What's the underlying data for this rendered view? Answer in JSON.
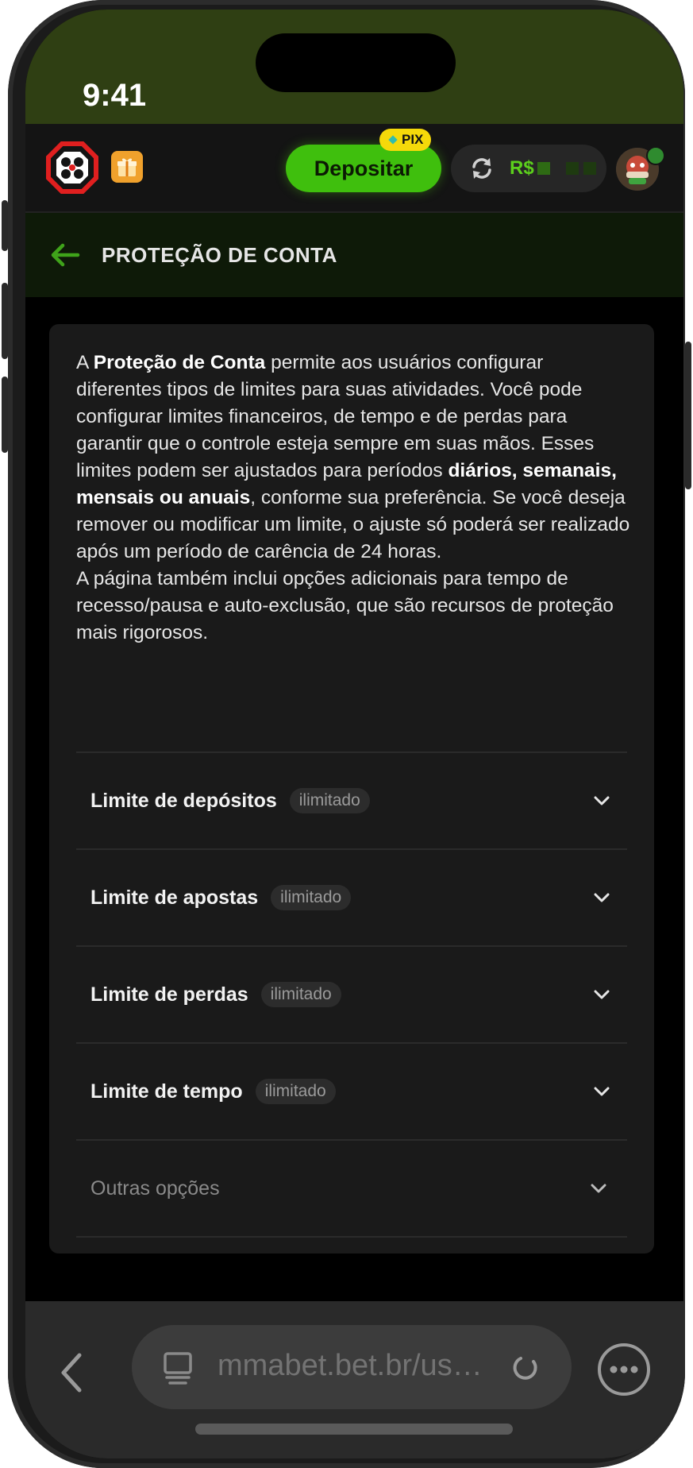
{
  "status_bar": {
    "time": "9:41"
  },
  "header": {
    "deposit_label": "Depositar",
    "pix_label": "PIX",
    "currency_label": "R$",
    "accent_color": "#3fbf0d"
  },
  "title_bar": {
    "title": "PROTEÇÃO DE CONTA"
  },
  "intro": {
    "p1_a": "A ",
    "p1_bold1": "Proteção de Conta",
    "p1_b": " permite aos usuários configurar diferentes tipos de limites para suas atividades. Você pode configurar limites financeiros, de tempo e de perdas para garantir que o controle esteja sempre em suas mãos. Esses limites podem ser ajustados para períodos ",
    "p1_bold2": "diários, semanais, mensais ou anuais",
    "p1_c": ", conforme sua preferência. Se você deseja remover ou modificar um limite, o ajuste só poderá ser realizado após um período de carência de 24 horas.",
    "p2": "A página também inclui opções adicionais para tempo de recesso/pausa e auto-exclusão, que são recursos de proteção mais rigorosos."
  },
  "limits": [
    {
      "label": "Limite de depósitos",
      "badge": "ilimitado"
    },
    {
      "label": "Limite de apostas",
      "badge": "ilimitado"
    },
    {
      "label": "Limite de perdas",
      "badge": "ilimitado"
    },
    {
      "label": "Limite de tempo",
      "badge": "ilimitado"
    }
  ],
  "other_options": {
    "label": "Outras opções"
  },
  "browser": {
    "url": "mmabet.bet.br/us…"
  }
}
